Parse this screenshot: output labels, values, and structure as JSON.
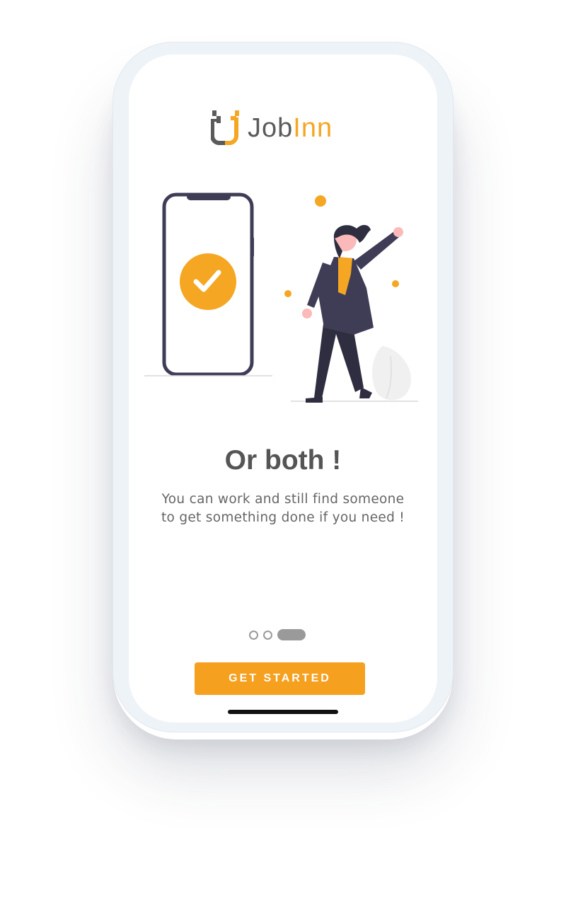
{
  "app": {
    "logo_word_1": "Job",
    "logo_word_2": "Inn",
    "logo_mark": "jobinn-logo-mark"
  },
  "onboarding": {
    "title": "Or both !",
    "description": "You can work and still find someone to get something done if you need !",
    "page_indicator": {
      "total": 3,
      "current": 3
    },
    "cta_label": "GET STARTED"
  },
  "illustration": {
    "icons": [
      "phone-icon",
      "checkmark-icon",
      "woman-celebrating-figure",
      "leaf-icon"
    ]
  },
  "colors": {
    "accent": "#f5a623",
    "button": "#f5a01f",
    "heading": "#555555",
    "body_text": "#666666",
    "dark": "#3f3d56",
    "device_frame": "#eef3f8"
  }
}
